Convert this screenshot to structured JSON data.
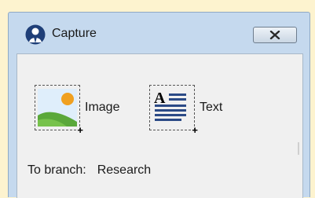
{
  "window": {
    "title": "Capture",
    "close_icon": "close-x-icon",
    "app_icon": "onenote-avatar-icon"
  },
  "options": [
    {
      "label": "Image",
      "icon": "image-icon"
    },
    {
      "label": "Text",
      "icon": "text-document-icon"
    }
  ],
  "branch": {
    "label": "To branch:",
    "value": "Research"
  },
  "colors": {
    "page_background": "#fdf3cf",
    "window_frame": "#c5d9ee",
    "content_background": "#f0f0f0",
    "text_icon_lines": "#2b4a86",
    "image_sun": "#f0a020",
    "image_hill": "#5aa83a"
  }
}
